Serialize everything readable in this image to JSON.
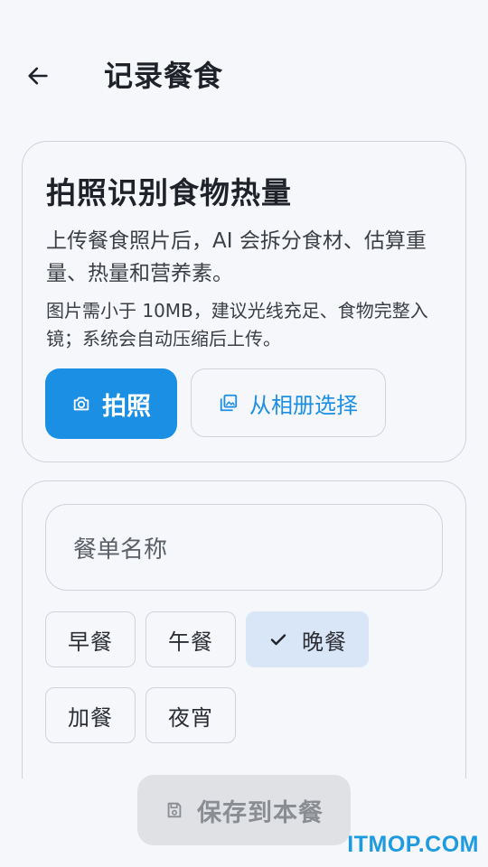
{
  "header": {
    "title": "记录餐食",
    "back_icon": "arrow-left-icon"
  },
  "photo_card": {
    "title": "拍照识别食物热量",
    "description": "上传餐食照片后，AI 会拆分食材、估算重量、热量和营养素。",
    "hint": "图片需小于 10MB，建议光线充足、食物完整入镜；系统会自动压缩后上传。",
    "take_photo_label": "拍照",
    "take_photo_icon": "camera-icon",
    "album_label": "从相册选择",
    "album_icon": "image-icon"
  },
  "meal_card": {
    "name_placeholder": "餐单名称",
    "meal_types": [
      {
        "label": "早餐",
        "selected": false
      },
      {
        "label": "午餐",
        "selected": false
      },
      {
        "label": "晚餐",
        "selected": true
      },
      {
        "label": "加餐",
        "selected": false
      },
      {
        "label": "夜宵",
        "selected": false
      }
    ]
  },
  "footer": {
    "save_label": "保存到本餐",
    "save_icon": "save-icon",
    "save_enabled": false
  },
  "watermark": "ITMOP.COM",
  "colors": {
    "accent": "#1b8fe3",
    "selected_chip": "#d9e6f7",
    "disabled_button": "#dfe1e5",
    "background": "#f5f7fb",
    "watermark": "#1e9be0"
  }
}
